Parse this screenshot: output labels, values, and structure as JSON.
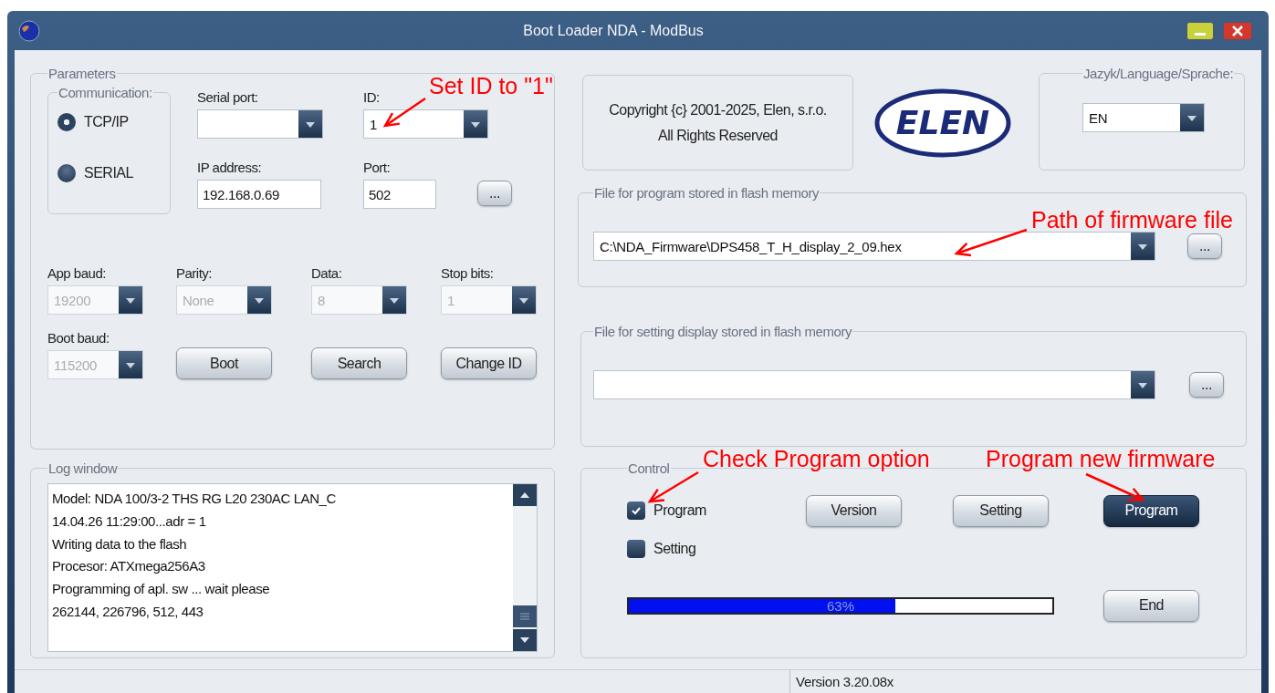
{
  "window": {
    "title": "Boot Loader NDA - ModBus"
  },
  "parameters": {
    "legend": "Parameters",
    "communication": {
      "legend": "Communication:",
      "options": [
        {
          "label": "TCP/IP",
          "selected": true
        },
        {
          "label": "SERIAL",
          "selected": false
        }
      ]
    },
    "fields": [
      {
        "label": "Serial port:",
        "kind": "dropdown",
        "disabled": false
      },
      {
        "label": "ID:",
        "kind": "dropdown",
        "value": "1",
        "disabled": false
      },
      {
        "label": "IP address:",
        "kind": "input",
        "value": "192.168.0.69"
      },
      {
        "label": "Port:",
        "kind": "input",
        "value": "502"
      }
    ],
    "browse_label": "...",
    "serial_settings": [
      {
        "label": "App baud:",
        "value": "19200",
        "disabled": true
      },
      {
        "label": "Parity:",
        "value": "None",
        "disabled": true
      },
      {
        "label": "Data:",
        "value": "8",
        "disabled": true
      },
      {
        "label": "Stop bits:",
        "value": "1",
        "disabled": true
      }
    ],
    "boot_baud": {
      "label": "Boot baud:",
      "value": "115200",
      "disabled": true
    },
    "buttons": [
      {
        "label": "Boot"
      },
      {
        "label": "Search"
      },
      {
        "label": "Change ID"
      }
    ]
  },
  "log": {
    "legend": "Log window",
    "lines": [
      "Model: NDA 100/3-2 THS RG L20 230AC LAN_C",
      "14.04.26  11:29:00...adr = 1",
      "Writing data to the flash",
      "Procesor: ATXmega256A3",
      "Programming of apl. sw ... wait please",
      "262144, 226796, 512, 443"
    ]
  },
  "copyright": {
    "lines": [
      "Copyright {c} 2001-2025, Elen, s.r.o.",
      "All Rights Reserved"
    ]
  },
  "logo": {
    "text": "ELEN"
  },
  "language": {
    "legend": "Jazyk/Language/Sprache:",
    "value": "EN"
  },
  "program_file": {
    "legend": "File for program stored in flash memory",
    "value": "C:\\NDA_Firmware\\DPS458_T_H_display_2_09.hex",
    "browse_label": "..."
  },
  "setting_file": {
    "legend": "File for setting display stored in flash memory",
    "browse_label": "..."
  },
  "control": {
    "legend": "Control",
    "options": [
      {
        "label": "Program",
        "checked": true
      },
      {
        "label": "Setting",
        "checked": false
      }
    ],
    "buttons": [
      {
        "label": "Version",
        "highlighted": false
      },
      {
        "label": "Setting",
        "highlighted": false
      },
      {
        "label": "Program",
        "highlighted": true
      }
    ],
    "progress": {
      "level": 0.63,
      "label": "63%"
    },
    "end_button": {
      "label": "End"
    }
  },
  "status_bar": {
    "version": "Version 3.20.08x"
  },
  "annotations": [
    {
      "text": "Set ID to \"1\""
    },
    {
      "text": "Path of firmware file"
    },
    {
      "text": "Check Program option"
    },
    {
      "text": "Program new firmware"
    }
  ]
}
